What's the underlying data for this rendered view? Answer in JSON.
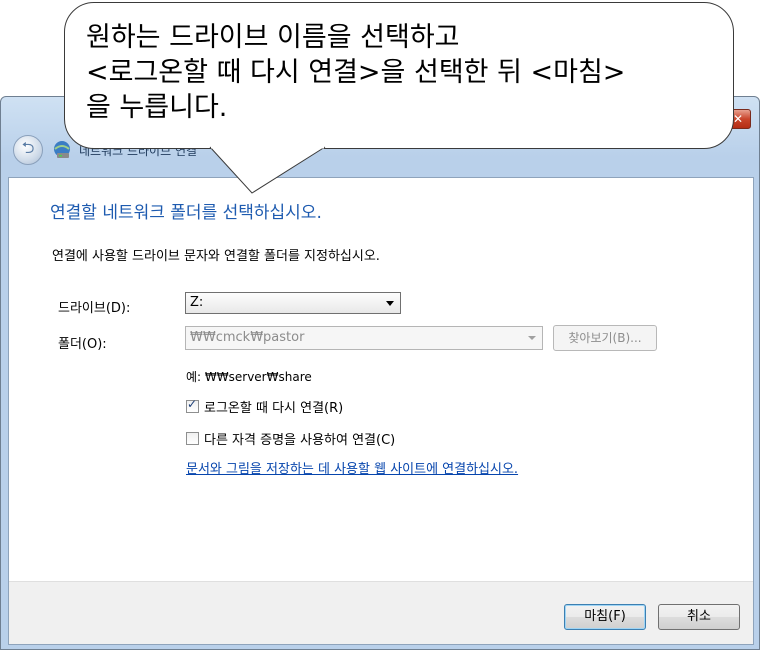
{
  "callout": {
    "lines": [
      "원하는 드라이브 이름을 선택하고",
      "<로그온할 때 다시 연결>을 선택한 뒤 <마침>",
      "을 누릅니다."
    ]
  },
  "window": {
    "title": "네트워크 드라이브 연결",
    "close_label": "✕"
  },
  "dialog": {
    "main_instruction": "연결할 네트워크 폴더를 선택하십시오.",
    "sub_instruction": "연결에 사용할 드라이브 문자와 연결할 폴더를 지정하십시오.",
    "drive_label": "드라이브(D):",
    "drive_value": "Z:",
    "folder_label": "폴더(O):",
    "folder_value": "₩₩cmck₩pastor",
    "browse_label": "찾아보기(B)...",
    "example": "예: ₩₩server₩share",
    "reconnect_label": "로그온할 때 다시 연결(R)",
    "reconnect_checked": true,
    "other_credentials_label": "다른 자격 증명을 사용하여 연결(C)",
    "other_credentials_checked": false,
    "link_text": "문서와 그림을 저장하는 데 사용할 웹 사이트에 연결하십시오.",
    "finish_label": "마침(F)",
    "cancel_label": "취소"
  },
  "colors": {
    "instruction_blue": "#1e5bb0",
    "link_blue": "#0645ad"
  }
}
